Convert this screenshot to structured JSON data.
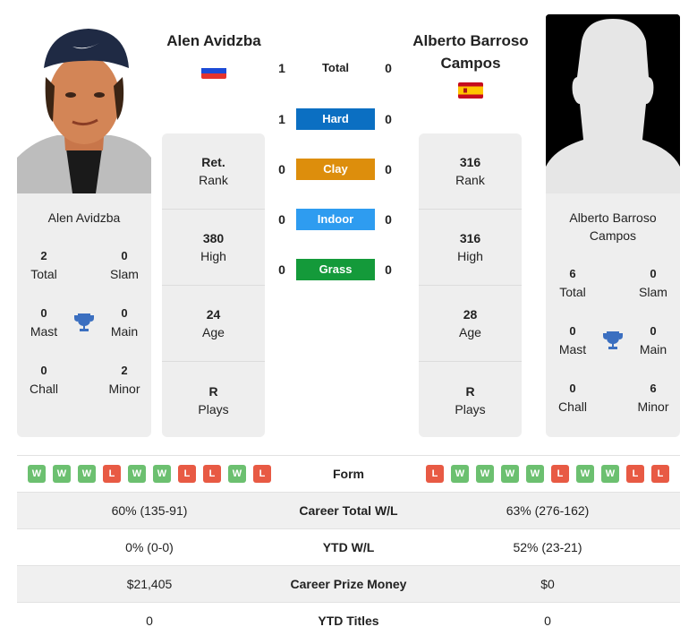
{
  "player_left": {
    "name": "Alen Avidzba",
    "card_name": "Alen Avidzba",
    "flag": "russia-flag",
    "flag_colors": [
      "#ffffff",
      "#1c4bd6",
      "#e4332d"
    ],
    "photo": "player-photo",
    "stats": [
      {
        "value": "Ret.",
        "label": "Rank"
      },
      {
        "value": "380",
        "label": "High"
      },
      {
        "value": "24",
        "label": "Age"
      },
      {
        "value": "R",
        "label": "Plays"
      }
    ],
    "titles": {
      "total": {
        "value": "2",
        "label": "Total"
      },
      "slam": {
        "value": "0",
        "label": "Slam"
      },
      "mast": {
        "value": "0",
        "label": "Mast"
      },
      "main": {
        "value": "0",
        "label": "Main"
      },
      "chall": {
        "value": "0",
        "label": "Chall"
      },
      "minor": {
        "value": "2",
        "label": "Minor"
      }
    },
    "form": [
      "W",
      "W",
      "W",
      "L",
      "W",
      "W",
      "L",
      "L",
      "W",
      "L"
    ]
  },
  "player_right": {
    "name": "Alberto Barroso Campos",
    "card_name": "Alberto Barroso Campos",
    "flag": "spain-flag",
    "flag_colors": [
      "#c60b1e",
      "#ffc400"
    ],
    "photo": "placeholder-silhouette",
    "stats": [
      {
        "value": "316",
        "label": "Rank"
      },
      {
        "value": "316",
        "label": "High"
      },
      {
        "value": "28",
        "label": "Age"
      },
      {
        "value": "R",
        "label": "Plays"
      }
    ],
    "titles": {
      "total": {
        "value": "6",
        "label": "Total"
      },
      "slam": {
        "value": "0",
        "label": "Slam"
      },
      "mast": {
        "value": "0",
        "label": "Mast"
      },
      "main": {
        "value": "0",
        "label": "Main"
      },
      "chall": {
        "value": "0",
        "label": "Chall"
      },
      "minor": {
        "value": "6",
        "label": "Minor"
      }
    },
    "form": [
      "L",
      "W",
      "W",
      "W",
      "W",
      "L",
      "W",
      "W",
      "L",
      "L"
    ]
  },
  "h2h": [
    {
      "label": "Total",
      "left": "1",
      "right": "0",
      "color": ""
    },
    {
      "label": "Hard",
      "left": "1",
      "right": "0",
      "color": "#0b6fc2"
    },
    {
      "label": "Clay",
      "left": "0",
      "right": "0",
      "color": "#dd8e0c"
    },
    {
      "label": "Indoor",
      "left": "0",
      "right": "0",
      "color": "#2e9cf0"
    },
    {
      "label": "Grass",
      "left": "0",
      "right": "0",
      "color": "#149a3a"
    }
  ],
  "comparison": {
    "form_label": "Form",
    "rows": [
      {
        "label": "Career Total W/L",
        "left": "60% (135-91)",
        "right": "63% (276-162)"
      },
      {
        "label": "YTD W/L",
        "left": "0% (0-0)",
        "right": "52% (23-21)"
      },
      {
        "label": "Career Prize Money",
        "left": "$21,405",
        "right": "$0"
      },
      {
        "label": "YTD Titles",
        "left": "0",
        "right": "0"
      }
    ]
  },
  "icons": {
    "trophy": "trophy-icon"
  },
  "colors": {
    "win": "#6cc070",
    "loss": "#e85a44",
    "trophy": "#3b6fc0",
    "card_bg": "#eeeeee"
  }
}
